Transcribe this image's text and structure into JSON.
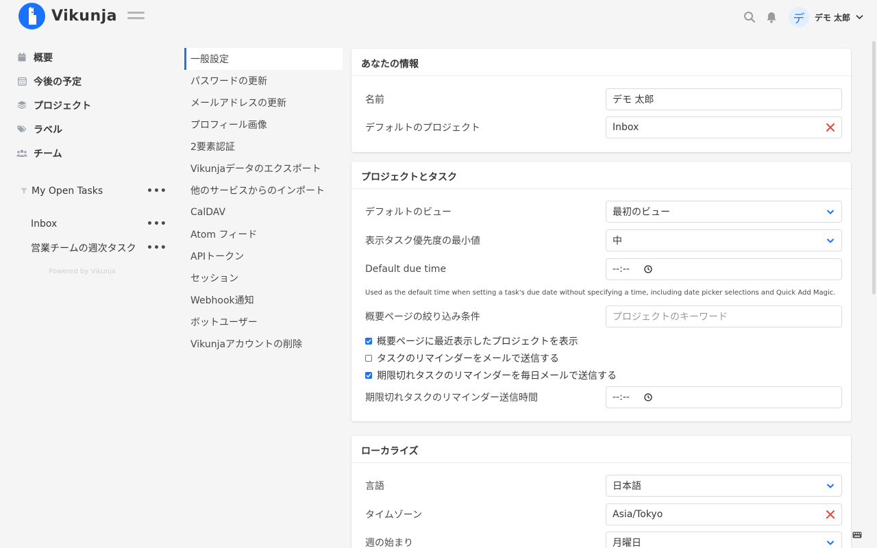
{
  "app": {
    "name": "Vikunja",
    "user": {
      "avatar_char": "デ",
      "name": "デモ 太郎"
    }
  },
  "sidebar": {
    "nav": [
      {
        "label": "概要",
        "icon": "calendar-icon"
      },
      {
        "label": "今後の予定",
        "icon": "calendar-grid-icon"
      },
      {
        "label": "プロジェクト",
        "icon": "layers-icon"
      },
      {
        "label": "ラベル",
        "icon": "tags-icon"
      },
      {
        "label": "チーム",
        "icon": "users-icon"
      }
    ],
    "projects": [
      {
        "label": "My Open Tasks",
        "icon": "filter-icon"
      },
      {
        "label": "Inbox"
      },
      {
        "label": "営業チームの週次タスク"
      }
    ],
    "powered_by": "Powered by Vikunja"
  },
  "settings_nav": [
    "一般設定",
    "パスワードの更新",
    "メールアドレスの更新",
    "プロフィール画像",
    "2要素認証",
    "Vikunjaデータのエクスポート",
    "他のサービスからのインポート",
    "CalDAV",
    "Atom フィード",
    "APIトークン",
    "セッション",
    "Webhook通知",
    "ボットユーザー",
    "Vikunjaアカウントの削除"
  ],
  "cards": {
    "info": {
      "title": "あなたの情報",
      "name_label": "名前",
      "name_value": "デモ 太郎",
      "default_project_label": "デフォルトのプロジェクト",
      "default_project_value": "Inbox"
    },
    "project_tasks": {
      "title": "プロジェクトとタスク",
      "default_view_label": "デフォルトのビュー",
      "default_view_value": "最初のビュー",
      "min_priority_label": "表示タスク優先度の最小値",
      "min_priority_value": "中",
      "due_time_label": "Default due time",
      "due_time_value": "--:--",
      "due_time_help": "Used as the default time when setting a task's due date without specifying a time, including date picker selections and Quick Add Magic.",
      "overview_filter_label": "概要ページの絞り込み条件",
      "overview_filter_placeholder": "プロジェクトのキーワード",
      "checks": [
        {
          "label": "概要ページに最近表示したプロジェクトを表示",
          "checked": true
        },
        {
          "label": "タスクのリマインダーをメールで送信する",
          "checked": false
        },
        {
          "label": "期限切れタスクのリマインダーを毎日メールで送信する",
          "checked": true
        }
      ],
      "overdue_time_label": "期限切れタスクのリマインダー送信時間",
      "overdue_time_value": "--:--"
    },
    "localize": {
      "title": "ローカライズ",
      "language_label": "言語",
      "language_value": "日本語",
      "timezone_label": "タイムゾーン",
      "timezone_value": "Asia/Tokyo",
      "week_start_label": "週の始まり",
      "week_start_value": "月曜日"
    }
  },
  "colors": {
    "accent": "#1973ff",
    "clear": "#e8453c"
  }
}
